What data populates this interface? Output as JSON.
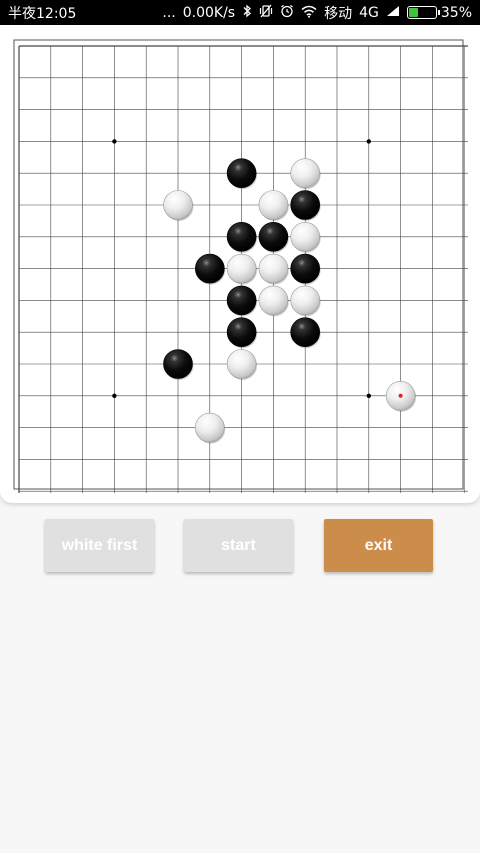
{
  "status_bar": {
    "time": "半夜12:05",
    "dots": "...",
    "network_speed": "0.00K/s",
    "carrier": "移动",
    "network_type": "4G",
    "battery": "35%",
    "battery_level": 0.35,
    "icons": [
      "bluetooth-icon",
      "vibrate-icon",
      "alarm-icon",
      "wifi-icon",
      "signal-icon",
      "battery-icon"
    ]
  },
  "board": {
    "size": 15,
    "star_points": [
      [
        3,
        3
      ],
      [
        11,
        3
      ],
      [
        3,
        11
      ],
      [
        11,
        11
      ]
    ],
    "stones": [
      {
        "col": 7,
        "row": 4,
        "color": "black"
      },
      {
        "col": 9,
        "row": 4,
        "color": "white"
      },
      {
        "col": 5,
        "row": 5,
        "color": "white"
      },
      {
        "col": 8,
        "row": 5,
        "color": "white"
      },
      {
        "col": 9,
        "row": 5,
        "color": "black"
      },
      {
        "col": 7,
        "row": 6,
        "color": "black"
      },
      {
        "col": 8,
        "row": 6,
        "color": "black"
      },
      {
        "col": 9,
        "row": 6,
        "color": "white"
      },
      {
        "col": 6,
        "row": 7,
        "color": "black"
      },
      {
        "col": 7,
        "row": 7,
        "color": "white"
      },
      {
        "col": 8,
        "row": 7,
        "color": "white"
      },
      {
        "col": 9,
        "row": 7,
        "color": "black"
      },
      {
        "col": 7,
        "row": 8,
        "color": "black"
      },
      {
        "col": 8,
        "row": 8,
        "color": "white"
      },
      {
        "col": 9,
        "row": 8,
        "color": "white"
      },
      {
        "col": 7,
        "row": 9,
        "color": "black"
      },
      {
        "col": 9,
        "row": 9,
        "color": "black"
      },
      {
        "col": 5,
        "row": 10,
        "color": "black"
      },
      {
        "col": 7,
        "row": 10,
        "color": "white"
      },
      {
        "col": 12,
        "row": 11,
        "color": "white",
        "last_move": true
      },
      {
        "col": 6,
        "row": 12,
        "color": "white"
      }
    ],
    "last_move_marker_color": "#e02020"
  },
  "buttons": {
    "white_first": "white first",
    "start": "start",
    "exit": "exit"
  },
  "colors": {
    "button_gray": "#e0e0e0",
    "button_exit": "#cc8d4a"
  }
}
